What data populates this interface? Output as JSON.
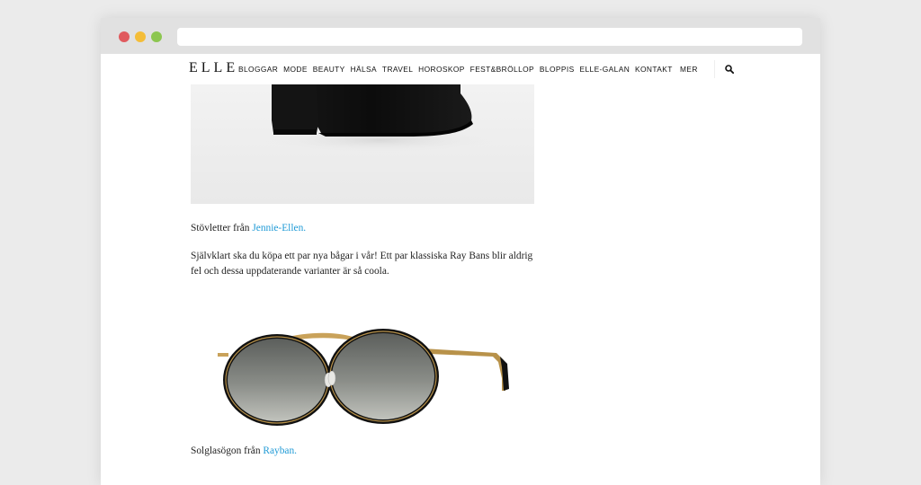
{
  "browser": {
    "url": ""
  },
  "nav": {
    "logo": "ELLE",
    "items": [
      "BLOGGAR",
      "MODE",
      "BEAUTY",
      "HÄLSA",
      "TRAVEL",
      "HOROSKOP",
      "FEST&BRÖLLOP",
      "BLOPPIS",
      "ELLE-GALAN",
      "KONTAKT"
    ],
    "more_label": "MER",
    "search_icon": "search-icon"
  },
  "article": {
    "caption1_prefix": "Stövletter från ",
    "caption1_link": "Jennie-Ellen.",
    "body_text": "Självklart ska du köpa ett par nya bågar i vår! Ett par klassiska Ray Bans blir aldrig fel och dessa uppdaterande varianter är så coola.",
    "caption2_prefix": "Solglasögon från ",
    "caption2_link": "Rayban."
  },
  "colors": {
    "link": "#1f9ad6",
    "chrome": "#e1e1e1",
    "dot_red": "#e05a5e",
    "dot_yellow": "#f4bd38",
    "dot_green": "#8cc650"
  }
}
